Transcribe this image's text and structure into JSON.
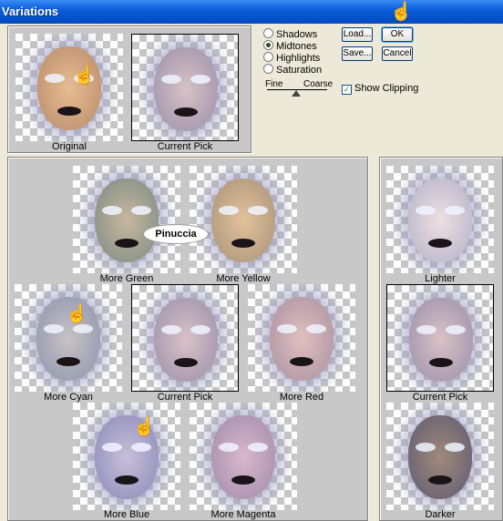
{
  "window": {
    "title": "Variations"
  },
  "top": {
    "original": "Original",
    "current_pick": "Current Pick"
  },
  "tones": [
    {
      "label": "Shadows",
      "selected": false
    },
    {
      "label": "Midtones",
      "selected": true
    },
    {
      "label": "Highlights",
      "selected": false
    },
    {
      "label": "Saturation",
      "selected": false
    }
  ],
  "slider": {
    "fine": "Fine",
    "coarse": "Coarse"
  },
  "buttons": {
    "ok": "OK",
    "cancel": "Cancel",
    "load": "Load...",
    "save": "Save..."
  },
  "show_clipping": {
    "label": "Show Clipping",
    "checked": true
  },
  "grid": {
    "more_green": "More Green",
    "more_yellow": "More Yellow",
    "more_cyan": "More Cyan",
    "current_pick": "Current Pick",
    "more_red": "More Red",
    "more_blue": "More Blue",
    "more_magenta": "More Magenta"
  },
  "lightness": {
    "lighter": "Lighter",
    "current_pick": "Current Pick",
    "darker": "Darker"
  },
  "watermark": "Pinuccia",
  "icons": {
    "pointer": "pointing-hand-icon"
  }
}
